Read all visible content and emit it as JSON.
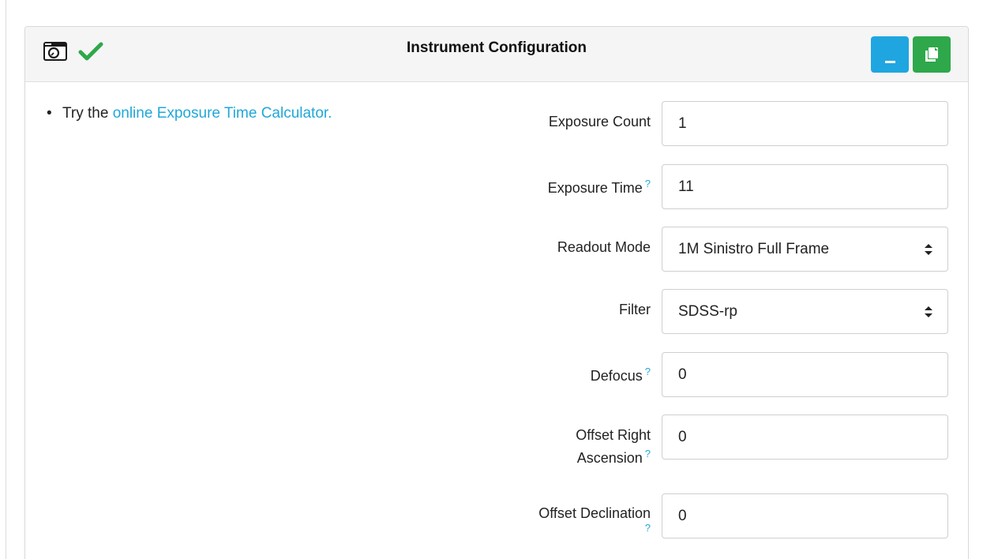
{
  "panel": {
    "title": "Instrument Configuration",
    "status": "valid"
  },
  "icons": {
    "camera": "camera-icon",
    "check": "check-icon",
    "minimize": "minimize-icon",
    "copy": "copy-icon"
  },
  "colors": {
    "accent_blue": "#1fa6e0",
    "accent_green": "#2ea84a",
    "link": "#20a8d8",
    "check": "#2ea84a"
  },
  "tip": {
    "prefix": "Try the ",
    "link_text": "online Exposure Time Calculator."
  },
  "form": {
    "exposure_count": {
      "label": "Exposure Count",
      "value": "1"
    },
    "exposure_time": {
      "label": "Exposure Time",
      "value": "11",
      "help": "?"
    },
    "readout_mode": {
      "label": "Readout Mode",
      "value": "1M Sinistro Full Frame"
    },
    "filter": {
      "label": "Filter",
      "value": "SDSS-rp"
    },
    "defocus": {
      "label": "Defocus",
      "value": "0",
      "help": "?"
    },
    "offset_ra": {
      "label_line1": "Offset Right",
      "label_line2": "Ascension",
      "value": "0",
      "help": "?"
    },
    "offset_dec": {
      "label": "Offset Declination",
      "value": "0",
      "help": "?"
    }
  }
}
